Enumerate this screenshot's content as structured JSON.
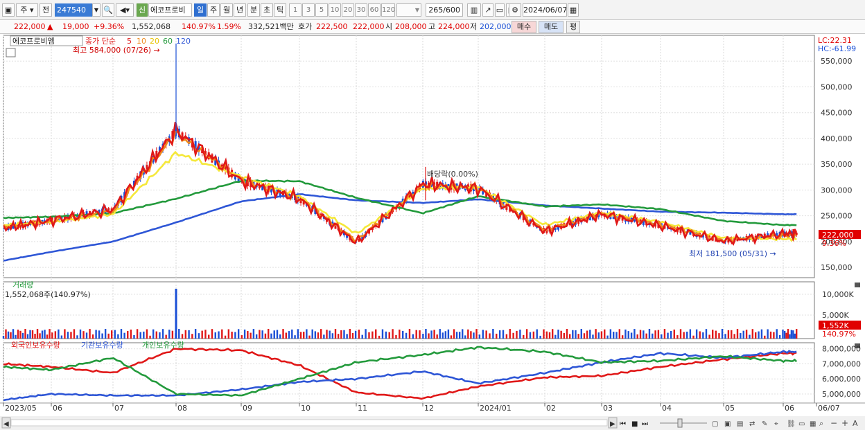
{
  "toolbar": {
    "market": "주",
    "prev": "전",
    "code": "247540",
    "name": "에코프로비",
    "sin": "신",
    "periods": [
      "일",
      "주",
      "월",
      "년",
      "분",
      "초",
      "틱"
    ],
    "nums": [
      "1",
      "3",
      "5",
      "10",
      "20",
      "30",
      "60",
      "120"
    ],
    "count": "265",
    "total": "/600",
    "date": "2024/06/07"
  },
  "quote": {
    "price": "222,000",
    "arrow": "▲",
    "change": "19,000",
    "rate": "+9.36%",
    "volume": "1,552,068",
    "vol_ratio": "140.97%",
    "turnover": "1.59%",
    "amount": "332,521백만",
    "bid_label": "호가",
    "ask": "222,500",
    "bid": "222,000",
    "open_label": "시",
    "open": "208,000",
    "high_label": "고",
    "high": "224,000",
    "low_label": "저",
    "low": "202,000",
    "buy": "매수",
    "sell": "매도",
    "flat": "평"
  },
  "price_panel": {
    "name": "에코프로비엠",
    "ma_title": "종가 단순",
    "ma_labels": [
      "5",
      "10",
      "20",
      "60",
      "120"
    ],
    "ma_colors": [
      "#e01818",
      "#f08a1c",
      "#f5e83a",
      "#239a3c",
      "#2e56d6"
    ],
    "high_note": "최고 584,000 (07/26) →",
    "low_note": "최저 181,500 (05/31) →",
    "div_note": "배당락(0.00%)",
    "lc": "LC:22.31",
    "hc": "HC:-61.99",
    "last_price": "222,000",
    "last_rate": "9.36%",
    "y_ticks": [
      "550,000",
      "500,000",
      "450,000",
      "400,000",
      "350,000",
      "300,000",
      "250,000",
      "200,000",
      "150,000"
    ]
  },
  "volume_panel": {
    "title": "거래량",
    "value": "1,552,068주(140.97%)",
    "y_ticks": [
      "10,000K",
      "5,000K"
    ],
    "last": "1,552K",
    "last_rate": "140.97%"
  },
  "holding_panel": {
    "labels": [
      "외국인보유수량",
      "기관보유수량",
      "개인보유수량"
    ],
    "colors": [
      "#e01818",
      "#2e56d6",
      "#239a3c"
    ],
    "y_ticks": [
      "8,000,000",
      "7,000,000",
      "6,000,000",
      "5,000,000"
    ]
  },
  "x_axis": [
    "2023/05",
    "06",
    "07",
    "08",
    "09",
    "10",
    "11",
    "12",
    "2024/01",
    "02",
    "03",
    "04",
    "05",
    "06",
    "06/07"
  ],
  "chart_data": {
    "type": "line",
    "x": [
      "2023/05",
      "06",
      "07",
      "08",
      "09",
      "10",
      "11",
      "12",
      "2024/01",
      "02",
      "03",
      "04",
      "05",
      "06",
      "06/07"
    ],
    "series": [
      {
        "name": "5",
        "values": [
          226000,
          241000,
          262000,
          415000,
          318000,
          283000,
          198000,
          311000,
          303000,
          220000,
          253000,
          231000,
          201000,
          215000,
          215000
        ]
      },
      {
        "name": "10",
        "values": [
          228000,
          240000,
          258000,
          410000,
          320000,
          284000,
          202000,
          309000,
          304000,
          223000,
          254000,
          234000,
          203000,
          211000,
          211000
        ]
      },
      {
        "name": "20",
        "values": [
          232000,
          238000,
          253000,
          372000,
          326000,
          288000,
          215000,
          303000,
          306000,
          232000,
          256000,
          238000,
          207000,
          205000,
          205000
        ]
      },
      {
        "name": "60",
        "values": [
          246000,
          248000,
          255000,
          283000,
          318000,
          317000,
          285000,
          255000,
          288000,
          268000,
          272000,
          263000,
          240000,
          232000,
          232000
        ]
      },
      {
        "name": "120",
        "values": [
          163000,
          180000,
          200000,
          237000,
          278000,
          292000,
          280000,
          275000,
          282000,
          270000,
          264000,
          258000,
          256000,
          253000,
          253000
        ]
      },
      {
        "name": "외국인보유수량",
        "values": [
          7000000,
          6800000,
          6400000,
          8000000,
          7900000,
          6900000,
          5100000,
          4700000,
          5500000,
          6100000,
          6200000,
          6800000,
          7300000,
          7700000,
          7700000
        ]
      },
      {
        "name": "기관보유수량",
        "values": [
          4600000,
          5000000,
          4900000,
          4900000,
          5300000,
          5800000,
          6000000,
          6500000,
          5700000,
          6400000,
          7100000,
          7700000,
          7400000,
          7800000,
          7800000
        ]
      },
      {
        "name": "개인보유수량",
        "values": [
          6800000,
          6600000,
          7400000,
          5000000,
          4900000,
          6000000,
          7100000,
          7600000,
          8100000,
          7800000,
          7100000,
          7200000,
          7500000,
          7200000,
          7200000
        ]
      }
    ],
    "y_ticks": [
      "550,000",
      "500,000",
      "450,000",
      "400,000",
      "350,000",
      "300,000",
      "250,000",
      "200,000",
      "150,000"
    ],
    "ylim": [
      130000,
      600000
    ]
  }
}
